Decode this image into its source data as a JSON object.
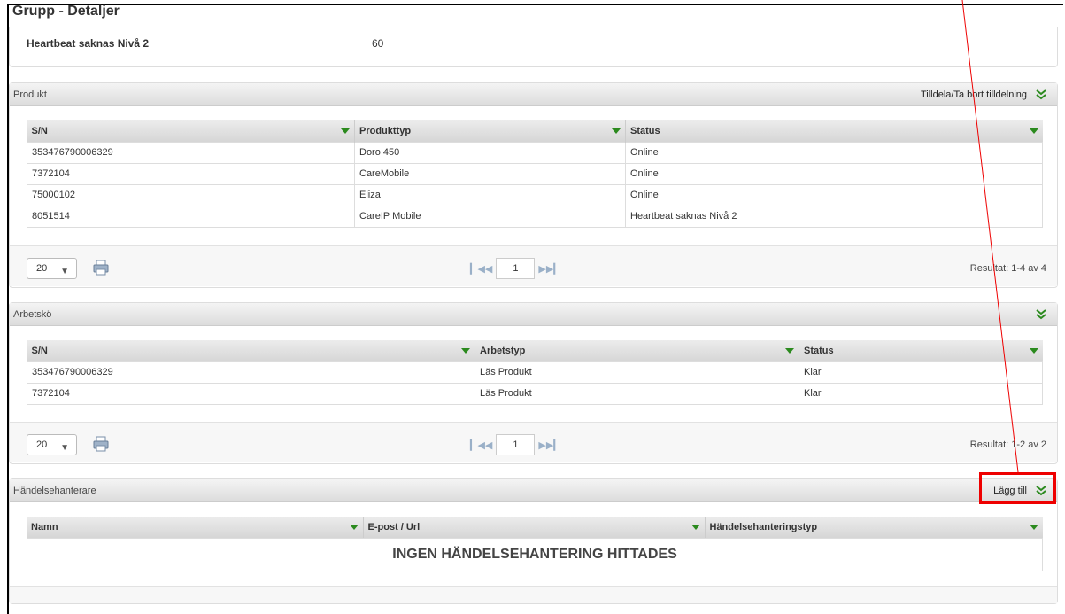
{
  "page_title": "Grupp - Detaljer",
  "detail": {
    "label": "Heartbeat saknas Nivå 2",
    "value": "60"
  },
  "produkt": {
    "title": "Produkt",
    "action_label": "Tilldela/Ta bort tilldelning",
    "columns": [
      "S/N",
      "Produkttyp",
      "Status"
    ],
    "rows": [
      {
        "sn": "353476790006329",
        "type": "Doro 450",
        "status": "Online",
        "alert": false
      },
      {
        "sn": "7372104",
        "type": "CareMobile",
        "status": "Online",
        "alert": false
      },
      {
        "sn": "75000102",
        "type": "Eliza",
        "status": "Online",
        "alert": false
      },
      {
        "sn": "8051514",
        "type": "CareIP Mobile",
        "status": "Heartbeat saknas Nivå 2",
        "alert": true
      }
    ],
    "pager": {
      "page_size": "20",
      "page": "1",
      "result": "Resultat: 1-4 av 4"
    }
  },
  "arbetsko": {
    "title": "Arbetskö",
    "columns": [
      "S/N",
      "Arbetstyp",
      "Status"
    ],
    "rows": [
      {
        "sn": "353476790006329",
        "type": "Läs Produkt",
        "status": "Klar"
      },
      {
        "sn": "7372104",
        "type": "Läs Produkt",
        "status": "Klar"
      }
    ],
    "pager": {
      "page_size": "20",
      "page": "1",
      "result": "Resultat: 1-2 av 2"
    }
  },
  "handelse": {
    "title": "Händelsehanterare",
    "action_label": "Lägg till",
    "columns": [
      "Namn",
      "E-post / Url",
      "Händelsehanteringstyp"
    ],
    "empty_message": "INGEN HÄNDELSEHANTERING HITTADES"
  },
  "colors": {
    "accent_green": "#2b8a1e",
    "alert_red": "#e02020",
    "annotation_red": "#ee0000"
  },
  "icons": {
    "expand": "double-chevron-down-icon",
    "print": "printer-icon",
    "sort": "caret-down-icon"
  }
}
